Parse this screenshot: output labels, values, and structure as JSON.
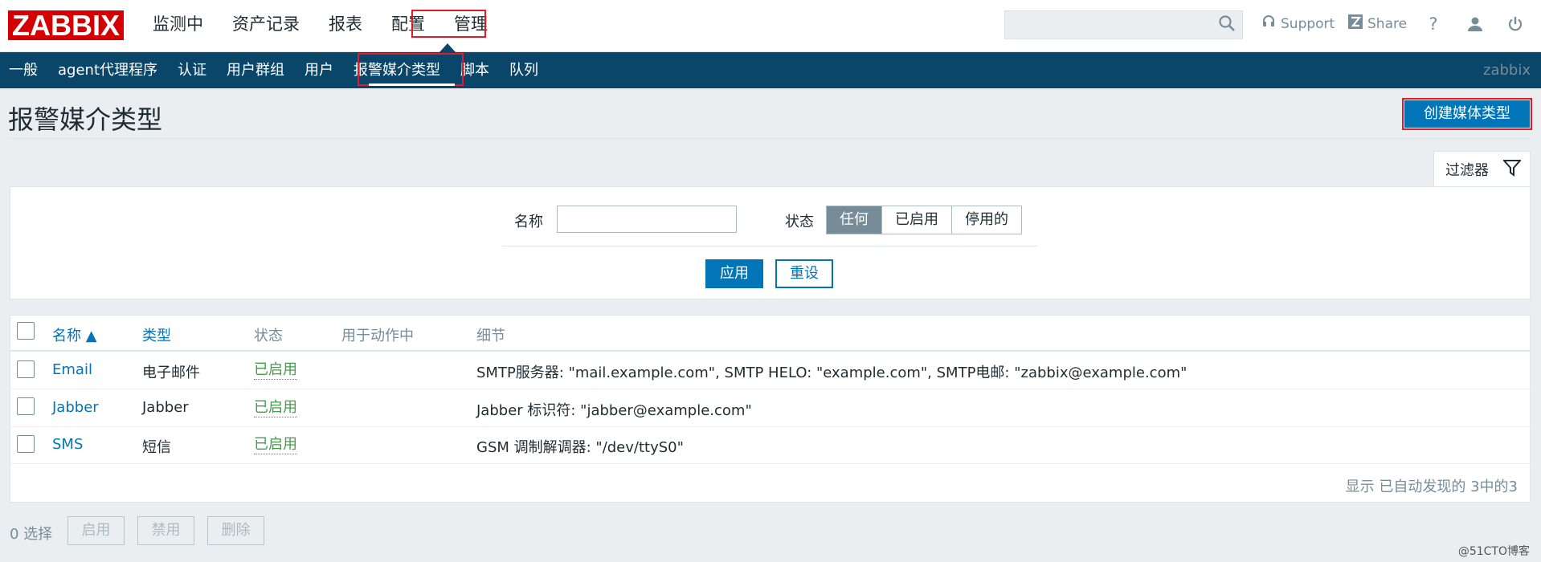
{
  "header": {
    "logo": "ZABBIX",
    "menu": [
      "监测中",
      "资产记录",
      "报表",
      "配置",
      "管理"
    ],
    "support_label": "Support",
    "share_label": "Share",
    "help_label": "?"
  },
  "subnav": {
    "items": [
      "一般",
      "agent代理程序",
      "认证",
      "用户群组",
      "用户",
      "报警媒介类型",
      "脚本",
      "队列"
    ],
    "user": "zabbix"
  },
  "page": {
    "title": "报警媒介类型",
    "create_button": "创建媒体类型"
  },
  "filter": {
    "tab_label": "过滤器",
    "name_label": "名称",
    "name_value": "",
    "status_label": "状态",
    "status_options": [
      "任何",
      "已启用",
      "停用的"
    ],
    "status_selected": "任何",
    "apply_label": "应用",
    "reset_label": "重设"
  },
  "table": {
    "columns": [
      "名称 ▲",
      "类型",
      "状态",
      "用于动作中",
      "细节"
    ],
    "rows": [
      {
        "name": "Email",
        "type": "电子邮件",
        "status": "已启用",
        "used": "",
        "details": "SMTP服务器: \"mail.example.com\", SMTP HELO: \"example.com\", SMTP电邮: \"zabbix@example.com\""
      },
      {
        "name": "Jabber",
        "type": "Jabber",
        "status": "已启用",
        "used": "",
        "details": "Jabber 标识符: \"jabber@example.com\""
      },
      {
        "name": "SMS",
        "type": "短信",
        "status": "已启用",
        "used": "",
        "details": "GSM 调制解调器: \"/dev/ttyS0\""
      }
    ],
    "footer": "显示 已自动发现的 3中的3"
  },
  "bulk": {
    "selected": "0 选择",
    "enable": "启用",
    "disable": "禁用",
    "delete": "删除"
  },
  "watermark": "@51CTO博客",
  "colors": {
    "brand": "#d40000",
    "nav": "#0a466a",
    "accent": "#0275b8",
    "enabled": "#429e47",
    "highlight": "#e01c2b"
  }
}
